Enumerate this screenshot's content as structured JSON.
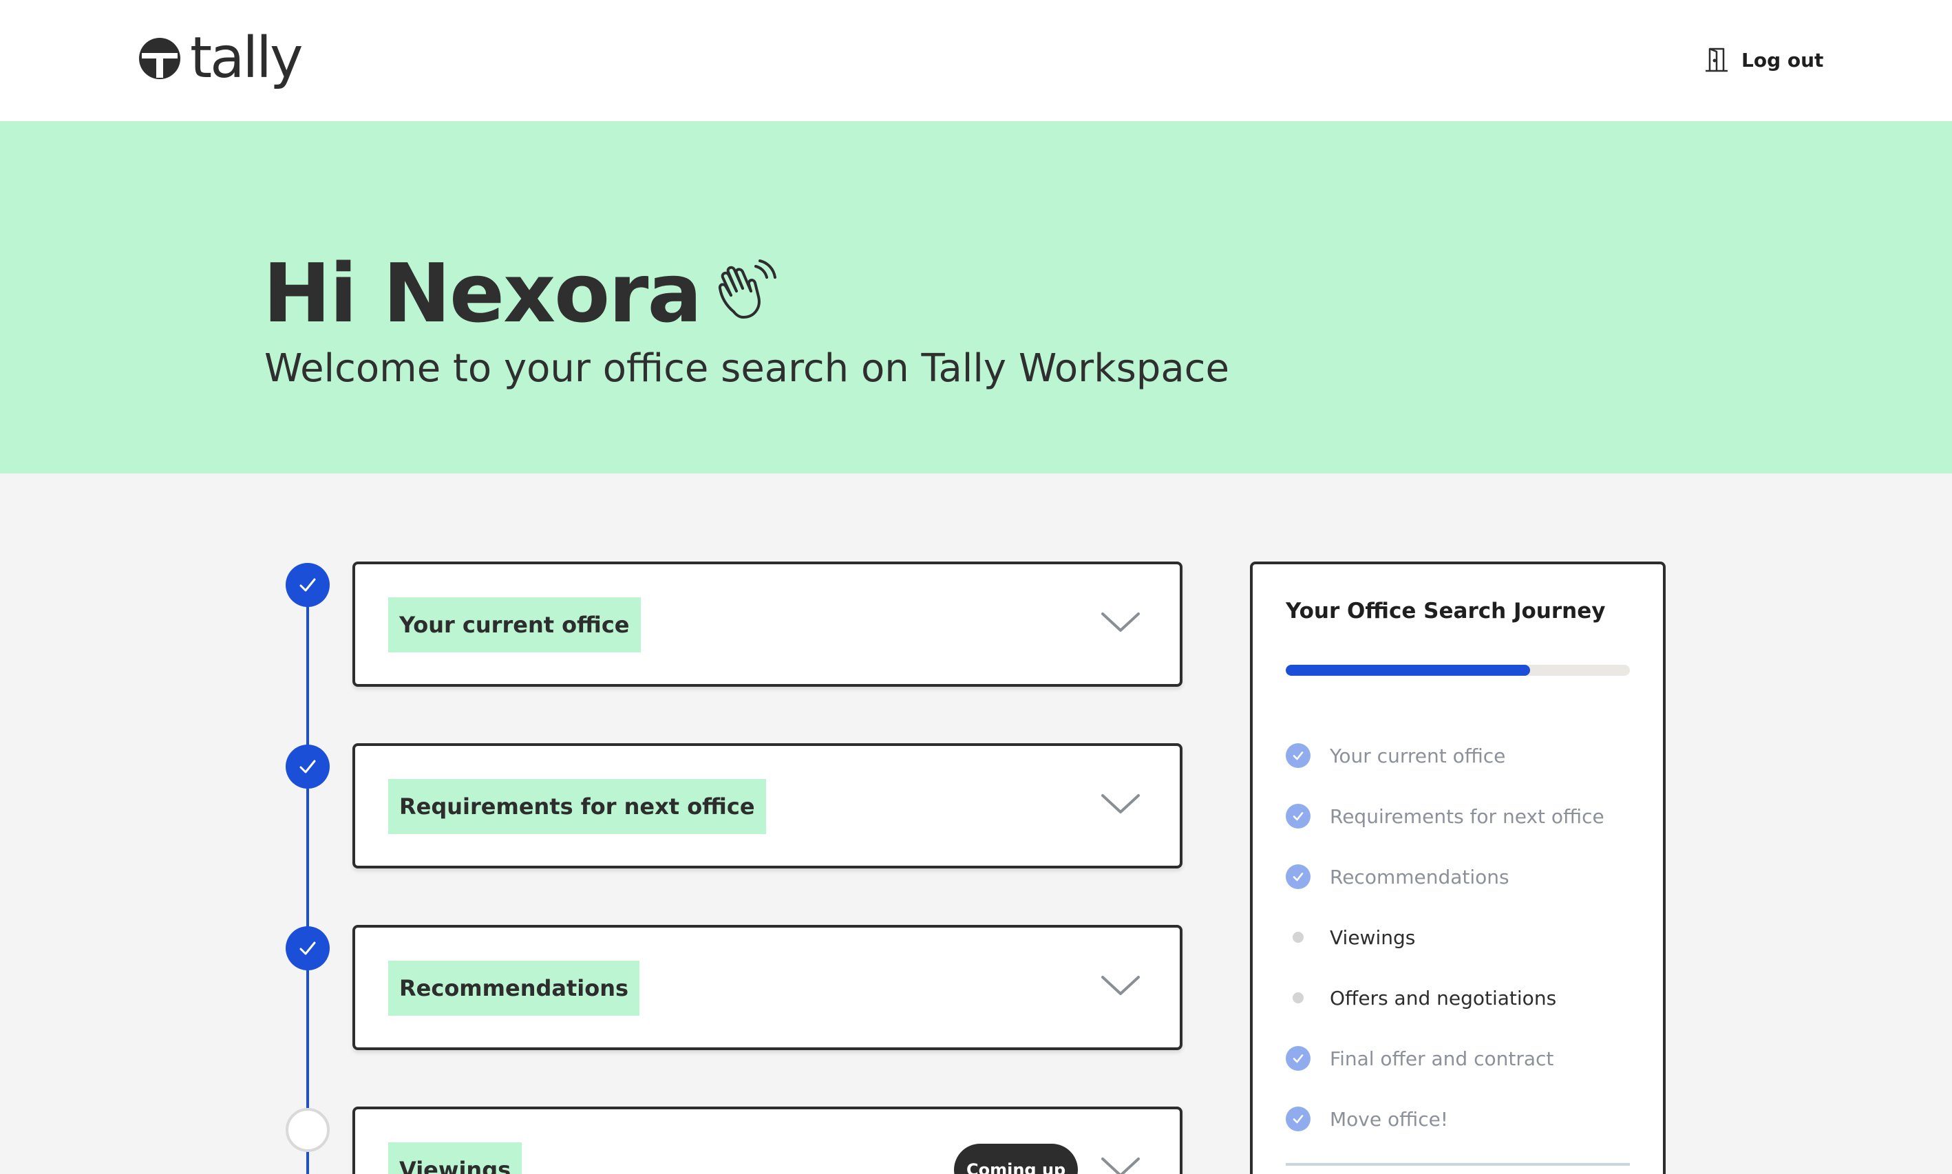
{
  "brand": {
    "name": "tally"
  },
  "header": {
    "logout_label": "Log out"
  },
  "hero": {
    "greeting": "Hi Nexora",
    "subtitle": "Welcome to your office search on Tally Workspace"
  },
  "steps": [
    {
      "label": "Your current office",
      "status": "done"
    },
    {
      "label": "Requirements for next office",
      "status": "done"
    },
    {
      "label": "Recommendations",
      "status": "done"
    },
    {
      "label": "Viewings",
      "status": "upcoming",
      "badge": "Coming up"
    }
  ],
  "journey": {
    "title": "Your Office Search Journey",
    "progress_percent": 71,
    "items": [
      {
        "label": "Your current office",
        "status": "done"
      },
      {
        "label": "Requirements for next office",
        "status": "done"
      },
      {
        "label": "Recommendations",
        "status": "done"
      },
      {
        "label": "Viewings",
        "status": "pending"
      },
      {
        "label": "Offers and negotiations",
        "status": "pending"
      },
      {
        "label": "Final offer and contract",
        "status": "done"
      },
      {
        "label": "Move office!",
        "status": "done"
      }
    ]
  },
  "colors": {
    "accent_blue": "#1c4fd8",
    "mint": "#bcf5d2",
    "dark": "#2d2d2d"
  }
}
